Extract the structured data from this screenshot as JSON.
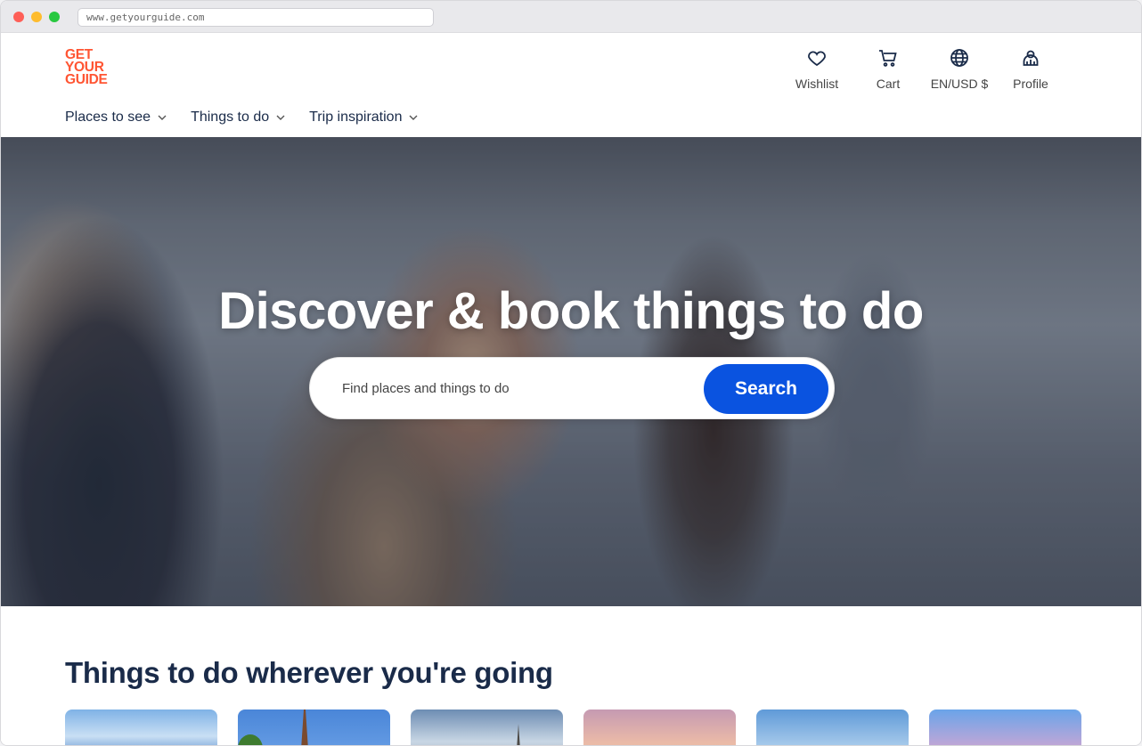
{
  "browser": {
    "url": "www.getyourguide.com"
  },
  "brand": {
    "logo_lines": [
      "GET",
      "YOUR",
      "GUIDE"
    ],
    "color": "#ff5533"
  },
  "header_actions": [
    {
      "label": "Wishlist",
      "icon": "heart-icon"
    },
    {
      "label": "Cart",
      "icon": "cart-icon"
    },
    {
      "label": "EN/USD $",
      "icon": "globe-icon"
    },
    {
      "label": "Profile",
      "icon": "profile-icon"
    }
  ],
  "nav": {
    "items": [
      {
        "label": "Places to see"
      },
      {
        "label": "Things to do"
      },
      {
        "label": "Trip inspiration"
      }
    ]
  },
  "hero": {
    "title": "Discover & book things to do",
    "search_placeholder": "Find places and things to do",
    "search_button": "Search",
    "button_color": "#0a53e0"
  },
  "section": {
    "title": "Things to do wherever you're going"
  },
  "colors": {
    "text_dark": "#1a2b49"
  }
}
